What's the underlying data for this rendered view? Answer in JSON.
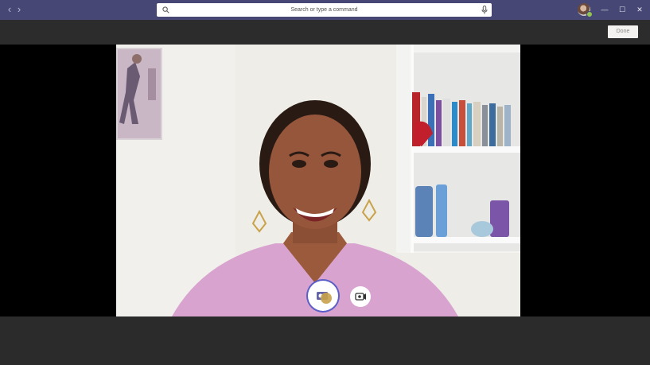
{
  "window": {
    "search_placeholder": "Search or type a command",
    "back_glyph": "‹",
    "forward_glyph": "›",
    "minimize_glyph": "—",
    "maximize_glyph": "☐",
    "close_glyph": "✕"
  },
  "toolbar": {
    "done_label": "Done"
  },
  "colors": {
    "titlebar": "#464775",
    "accent": "#5b5fc7",
    "presence_available": "#92c353",
    "stage": "#000000"
  },
  "icons": {
    "back": "chevron-left-icon",
    "forward": "chevron-right-icon",
    "search": "search-icon",
    "mic": "microphone-icon",
    "photo_capture": "photo-capture-icon",
    "switch_camera": "switch-camera-icon"
  }
}
